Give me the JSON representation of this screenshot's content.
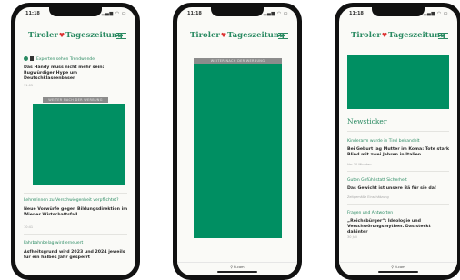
{
  "status": {
    "time": "11:18",
    "icons": "▂▄▆ ◠ ▭"
  },
  "app": {
    "logo_left": "Tiroler",
    "logo_right": "Tageszeitung"
  },
  "phone1": {
    "top_section": "Experten sehen Trendwende",
    "top_headline": "Das Handy muss nicht mehr sein: Bugwürdiger Hype um Deutschklassenbasen",
    "top_meta": "11:05",
    "ad_label": "WEITER NACH DER WERBUNG",
    "item2_section": "Lehrerinnen zu Verschwiegenheit verpflichtet?",
    "item2_headline": "Neue Vorwürfe gegen Bildungsdirektion im Wiener Wirtschaftsfall",
    "item2_meta": "10:41",
    "item3_section": "Fahrbahnbelag wird erneuert",
    "item3_headline": "Asfheitsgrund wird 2023 und 2024 jeweils für ein halbes Jahr gesperrt"
  },
  "phone2": {
    "ad_label": "WEITER NACH DER WERBUNG"
  },
  "phone3": {
    "title": "Newsticker",
    "items": [
      {
        "section": "Kinderarm wurde in Tirol behandelt",
        "headline": "Bei Geburt lag Mutter im Koma: Tote stark Blind mit zwei Jahren in Italien",
        "meta": "Vor 10 Minuten"
      },
      {
        "section": "Guten Gefühl statt Sicherheit",
        "headline": "Das Gewicht ist unsere Bä für sie da!",
        "meta": "Zeitgemäße Einschätzung"
      },
      {
        "section": "Fragen und Antworten",
        "headline": "„Reichsbürger“: Ideologie und Verschwörungsmythen. Das steckt dahinter",
        "meta": "30 Juli"
      }
    ]
  },
  "bottom": {
    "url": "⚲ tt.com"
  }
}
